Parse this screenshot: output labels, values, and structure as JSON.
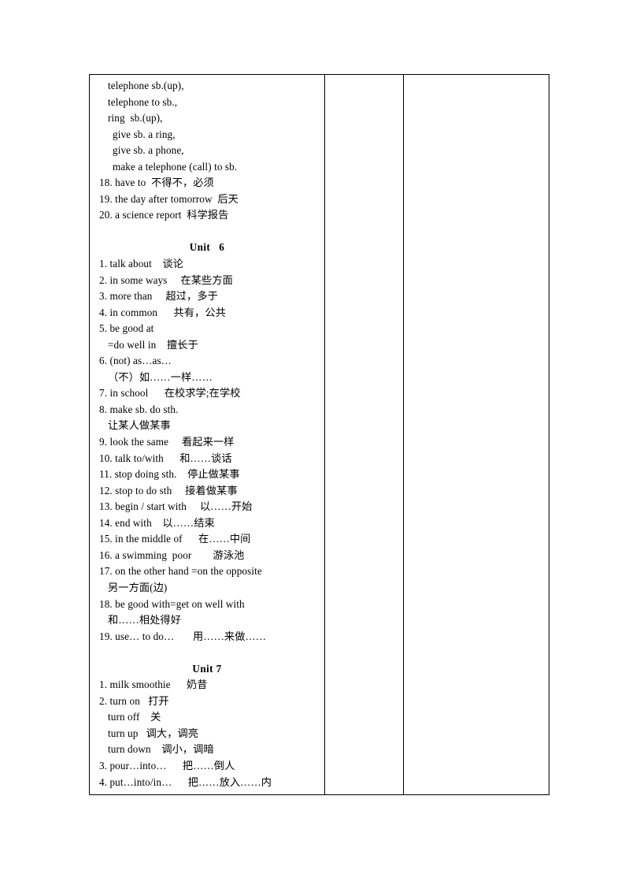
{
  "document": {
    "type": "vocabulary-phrase-list",
    "page_background": "#ffffff",
    "text_color": "#000000",
    "border_color": "#000000"
  },
  "table": {
    "columns": 3,
    "column_names": [
      "phrases-column",
      "middle-column",
      "right-column"
    ],
    "middle_column_content": "",
    "right_column_content": ""
  },
  "content": {
    "top_section_lines": [
      {
        "style": "sub",
        "text": "telephone sb.(up),"
      },
      {
        "style": "sub",
        "text": "telephone to sb.,"
      },
      {
        "style": "sub",
        "text": "ring  sb.(up),"
      },
      {
        "style": "sub2",
        "text": "give sb. a ring,"
      },
      {
        "style": "sub2",
        "text": "give sb. a phone,"
      },
      {
        "style": "sub2",
        "text": "make a telephone (call) to sb."
      },
      {
        "style": "num",
        "text": "18. have to  不得不，必须"
      },
      {
        "style": "num",
        "text": "19. the day after tomorrow  后天"
      },
      {
        "style": "num",
        "text": "20. a science report  科学报告"
      },
      {
        "style": "blank",
        "text": " "
      }
    ],
    "unit6": {
      "heading": "Unit   6",
      "lines": [
        {
          "style": "num",
          "text": "1. talk about    谈论"
        },
        {
          "style": "num",
          "text": "2. in some ways     在某些方面"
        },
        {
          "style": "num",
          "text": "3. more than     超过，多于"
        },
        {
          "style": "num",
          "text": "4. in common      共有，公共"
        },
        {
          "style": "num",
          "text": "5. be good at"
        },
        {
          "style": "sub",
          "text": "=do well in    擅长于"
        },
        {
          "style": "num",
          "text": "6. (not) as…as…"
        },
        {
          "style": "sub",
          "text": "（不）如……一样……"
        },
        {
          "style": "num",
          "text": "7. in school      在校求学;在学校"
        },
        {
          "style": "num",
          "text": "8. make sb. do sth."
        },
        {
          "style": "sub",
          "text": "让某人做某事"
        },
        {
          "style": "num",
          "text": "9. look the same     看起来一样"
        },
        {
          "style": "num",
          "text": "10. talk to/with      和……谈话"
        },
        {
          "style": "num",
          "text": "11. stop doing sth.    停止做某事"
        },
        {
          "style": "num",
          "text": "12. stop to do sth     接着做某事"
        },
        {
          "style": "num",
          "text": "13. begin / start with     以……开始"
        },
        {
          "style": "num",
          "text": "14. end with    以……结束"
        },
        {
          "style": "num",
          "text": "15. in the middle of      在……中间"
        },
        {
          "style": "num",
          "text": "16. a swimming  poor        游泳池"
        },
        {
          "style": "num",
          "text": "17. on the other hand =on the opposite"
        },
        {
          "style": "sub",
          "text": "另一方面(边)"
        },
        {
          "style": "num",
          "text": "18. be good with=get on well with"
        },
        {
          "style": "sub",
          "text": "和……相处得好"
        },
        {
          "style": "num",
          "text": "19. use… to do…       用……来做……"
        },
        {
          "style": "blank",
          "text": " "
        }
      ]
    },
    "unit7": {
      "heading": "Unit 7",
      "lines": [
        {
          "style": "num",
          "text": "1. milk smoothie      奶昔"
        },
        {
          "style": "num",
          "text": "2. turn on   打开"
        },
        {
          "style": "sub",
          "text": "turn off    关"
        },
        {
          "style": "sub",
          "text": "turn up   调大，调亮"
        },
        {
          "style": "sub",
          "text": "turn down    调小，调暗"
        },
        {
          "style": "num",
          "text": "3. pour…into…      把……倒人"
        },
        {
          "style": "num",
          "text": "4. put…into/in…      把……放入……内"
        }
      ]
    }
  }
}
